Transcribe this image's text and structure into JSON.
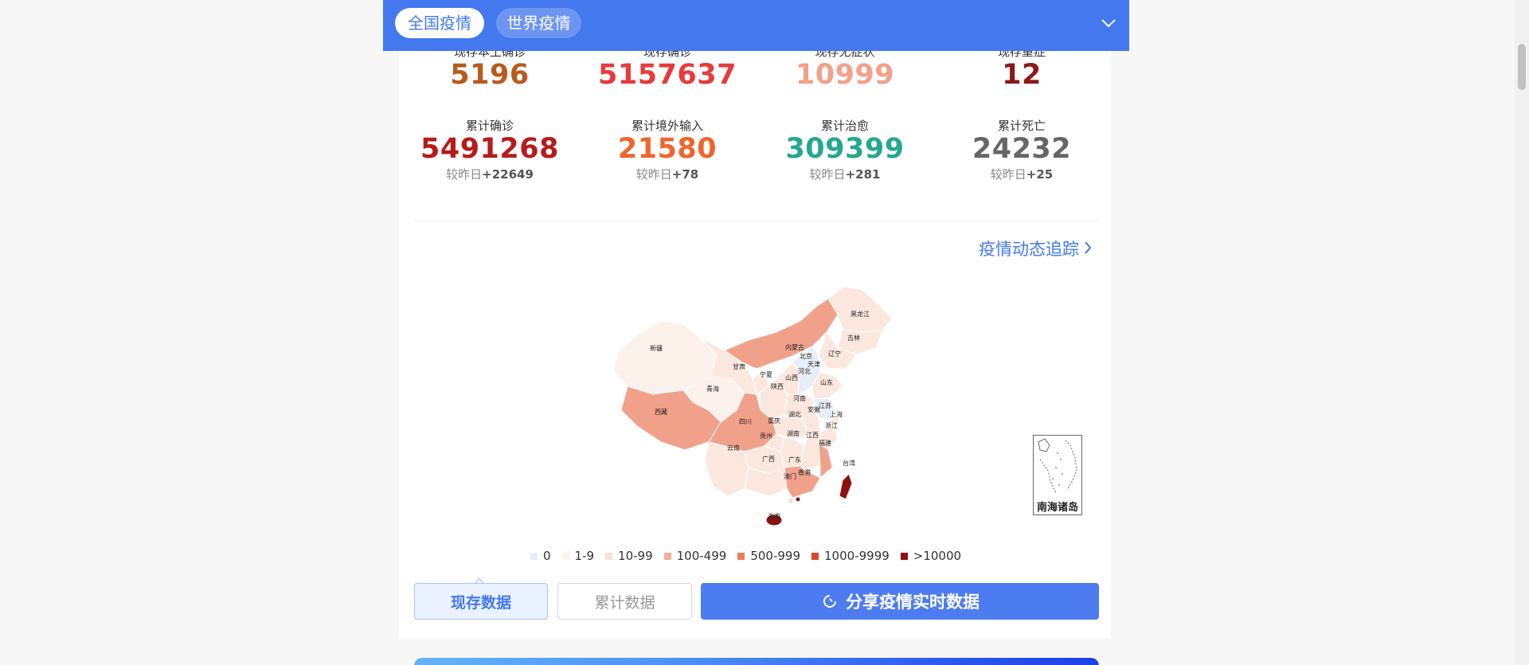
{
  "tabs": {
    "domestic": "全国疫情",
    "world": "世界疫情"
  },
  "stats_row1": [
    {
      "label": "现存本土确诊",
      "value": "5196",
      "color": "#b85a1c"
    },
    {
      "label": "现存确诊",
      "value": "5157637",
      "color": "#e83a3a"
    },
    {
      "label": "现存无症状",
      "value": "10999",
      "color": "#f4a08a"
    },
    {
      "label": "现存重症",
      "value": "12",
      "color": "#8b1a1a"
    }
  ],
  "stats_row2": [
    {
      "label": "累计确诊",
      "value": "5491268",
      "delta_prefix": "较昨日",
      "delta": "+22649",
      "color": "#b81a1a"
    },
    {
      "label": "累计境外输入",
      "value": "21580",
      "delta_prefix": "较昨日",
      "delta": "+78",
      "color": "#f0642a"
    },
    {
      "label": "累计治愈",
      "value": "309399",
      "delta_prefix": "较昨日",
      "delta": "+281",
      "color": "#23a88e"
    },
    {
      "label": "累计死亡",
      "value": "24232",
      "delta_prefix": "较昨日",
      "delta": "+25",
      "color": "#666666"
    }
  ],
  "tracking_link": "疫情动态追踪",
  "map": {
    "inset_label": "南海诸岛",
    "provinces": [
      {
        "name": "黑龙江",
        "color": "#fbe7de"
      },
      {
        "name": "吉林",
        "color": "#fbe7de"
      },
      {
        "name": "辽宁",
        "color": "#fbe7de"
      },
      {
        "name": "内蒙古",
        "color": "#f1a18a"
      },
      {
        "name": "北京",
        "color": "#fbe7de"
      },
      {
        "name": "天津",
        "color": "#fbe7de"
      },
      {
        "name": "河北",
        "color": "#e6eef8"
      },
      {
        "name": "山西",
        "color": "#fbe7de"
      },
      {
        "name": "新疆",
        "color": "#fdf1ec"
      },
      {
        "name": "甘肃",
        "color": "#fbe7de"
      },
      {
        "name": "宁夏",
        "color": "#fbe7de"
      },
      {
        "name": "陕西",
        "color": "#fbe7de"
      },
      {
        "name": "青海",
        "color": "#fdf1ec"
      },
      {
        "name": "山东",
        "color": "#fbe7de"
      },
      {
        "name": "河南",
        "color": "#fbe7de"
      },
      {
        "name": "江苏",
        "color": "#e6eef8"
      },
      {
        "name": "安徽",
        "color": "#fbe7de"
      },
      {
        "name": "上海",
        "color": "#fbe7de"
      },
      {
        "name": "浙江",
        "color": "#fbe7de"
      },
      {
        "name": "湖北",
        "color": "#fbe7de"
      },
      {
        "name": "西藏",
        "color": "#f1a18a"
      },
      {
        "name": "四川",
        "color": "#f1a18a"
      },
      {
        "name": "重庆",
        "color": "#fbe7de"
      },
      {
        "name": "贵州",
        "color": "#fbe7de"
      },
      {
        "name": "湖南",
        "color": "#fbe7de"
      },
      {
        "name": "江西",
        "color": "#fbe7de"
      },
      {
        "name": "福建",
        "color": "#f1a18a"
      },
      {
        "name": "云南",
        "color": "#fbe7de"
      },
      {
        "name": "广西",
        "color": "#fbe7de"
      },
      {
        "name": "广东",
        "color": "#f1a18a"
      },
      {
        "name": "香港",
        "color": "#8e1111"
      },
      {
        "name": "澳门",
        "color": "#fbe7de"
      },
      {
        "name": "台湾",
        "color": "#8e1111"
      },
      {
        "name": "海南",
        "color": "#fbe7de"
      }
    ]
  },
  "legend": [
    {
      "label": "0",
      "color": "#e6eef8"
    },
    {
      "label": "1-9",
      "color": "#fdf1ec"
    },
    {
      "label": "10-99",
      "color": "#fbe0d6"
    },
    {
      "label": "100-499",
      "color": "#f4b09d"
    },
    {
      "label": "500-999",
      "color": "#ec7d62"
    },
    {
      "label": "1000-9999",
      "color": "#d9492a"
    },
    {
      "label": ">10000",
      "color": "#8e1111"
    }
  ],
  "buttons": {
    "current": "现存数据",
    "cumulative": "累计数据",
    "share": "分享疫情实时数据"
  }
}
